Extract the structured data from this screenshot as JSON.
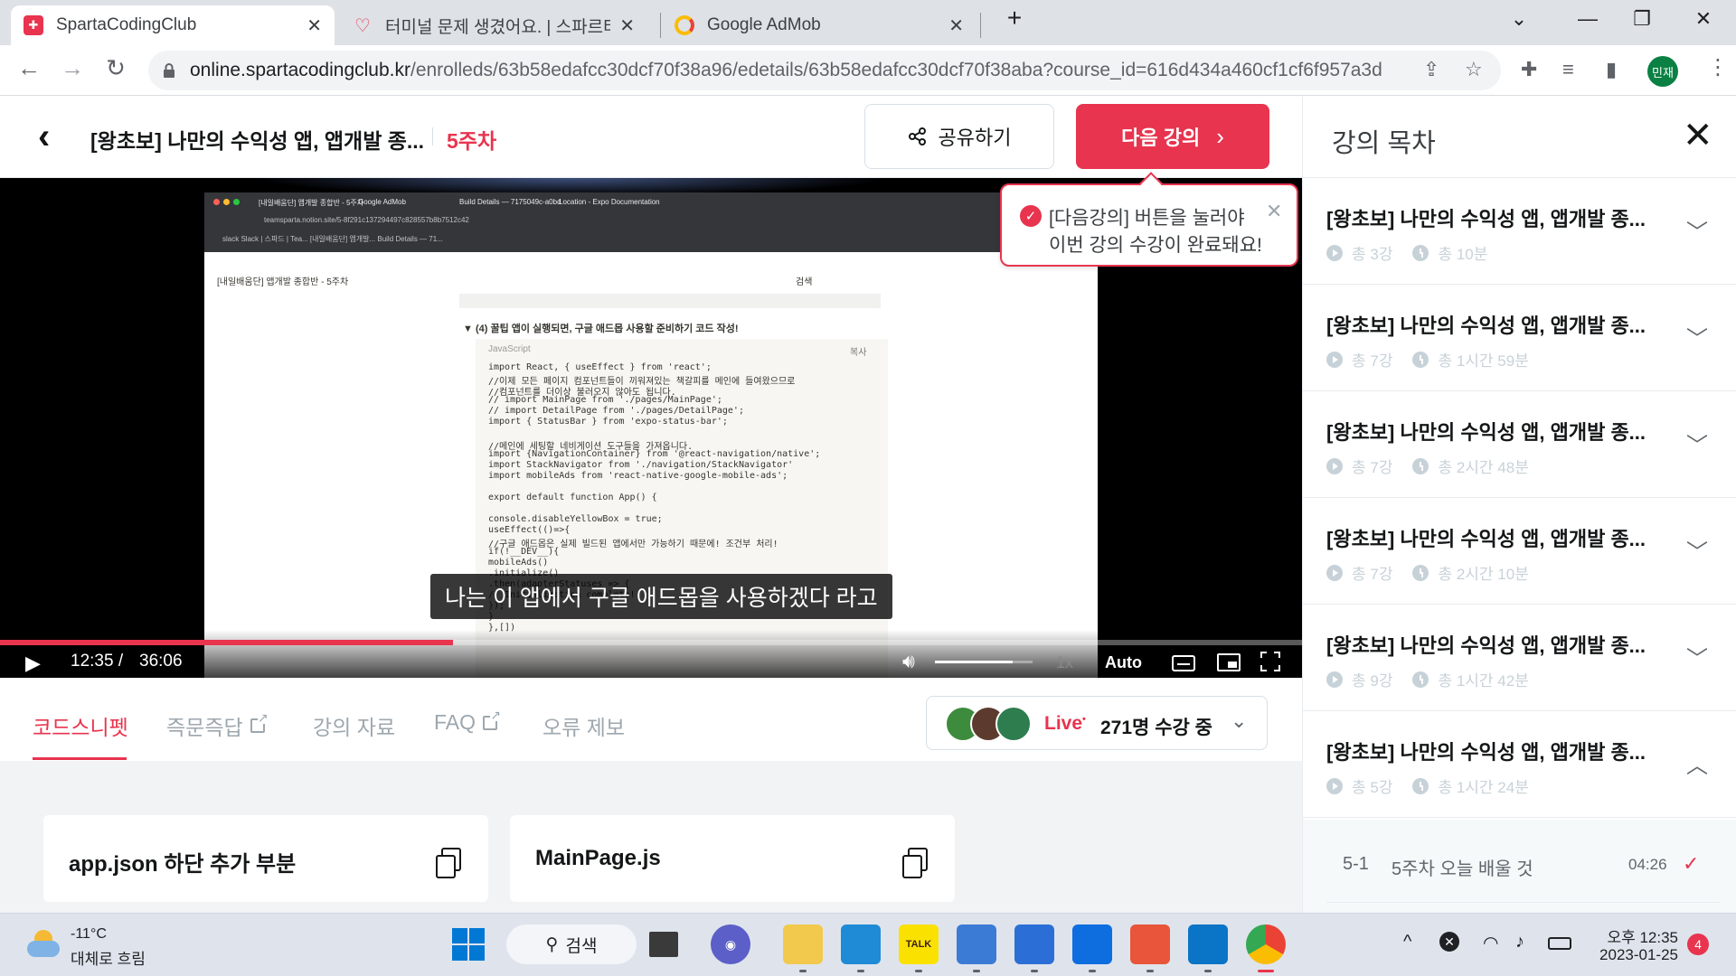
{
  "browser": {
    "tabs": [
      {
        "title": "SpartaCodingClub",
        "favicon_color": "#e8344e",
        "active": true
      },
      {
        "title": "터미널 문제 생겼어요. | 스파르타",
        "favicon_color": "#e8344e",
        "active": false
      },
      {
        "title": "Google AdMob",
        "favicon_color": "#fbbc04",
        "active": false
      }
    ],
    "new_tab": "+",
    "url_host": "online.spartacodingclub.kr",
    "url_path": "/enrolleds/63b58edafcc30dcf70f38a96/edetails/63b58edafcc30dcf70f38aba?course_id=616d434a460cf1cf6f957a3d",
    "profile_initials": "민재"
  },
  "header": {
    "course_title": "[왕초보] 나만의 수익성 앱, 앱개발 종...",
    "week": "5주차",
    "share_label": "공유하기",
    "next_label": "다음 강의"
  },
  "tooltip": {
    "line1": "[다음강의] 버튼을 눌러야",
    "line2": "이번 강의 수강이 완료돼요!"
  },
  "video": {
    "subtitle": "나는 이 앱에서 구글 애드몹을 사용하겠다 라고",
    "current_time": "12:35 /",
    "duration": "36:06",
    "progress": 0.348,
    "volume": 0.8,
    "speed": "1x",
    "quality": "Auto",
    "screen": {
      "tab_titles": [
        "[내일배움단] 앱개발 종합반 - 5주차",
        "Google AdMob",
        "Build Details — 7175049c-a0bd",
        "Location - Expo Documentation"
      ],
      "address": "teamsparta.notion.site/5-8f291c137294497c828557b8b7512c42",
      "bookmarks": "slack   Slack | 스파드 | Tea...   [내일배움단] 앱개발...   Build Details — 71...",
      "notion_header": "[내일배움단] 앱개발 종합반 - 5주차",
      "search_label": "검색",
      "section_heading": "▼  (4) 꿀팁 앱이 실행되면, 구글 애드몹 사용할 준비하기 코드 작성!",
      "code_lang": "JavaScript",
      "copy_label": "복사",
      "code_lines": [
        "import React, { useEffect } from 'react';",
        "//이제 모든 페이지 컴포넌트들이 끼워져있는 책갈피를 메인에 들여왔으므로",
        "//컴포넌트를 더이상 불러오지 않아도 됩니다.",
        "// import MainPage from './pages/MainPage';",
        "// import DetailPage from './pages/DetailPage';",
        "import { StatusBar } from 'expo-status-bar';",
        "",
        "//메인에 세팅할 네비게이션 도구들을 가져옵니다.",
        "import {NavigationContainer} from '@react-navigation/native';",
        "import StackNavigator from './navigation/StackNavigator'",
        "import mobileAds from 'react-native-google-mobile-ads';",
        "",
        "export default function App() {",
        "",
        "  console.disableYellowBox = true;",
        "  useEffect(()=>{",
        "    //구글 애드몹은 실제 빌드된 앱에서만 가능하기 때문에! 조건부 처리!",
        "    if(!__DEV__){",
        "      mobileAds()",
        "        .initialize()",
        "        .then(adapterStatuses => {",
        "          // Initialization complete!",
        "        });",
        "    }",
        "  },[])"
      ]
    }
  },
  "subtabs": [
    {
      "label": "코드스니펫",
      "active": true,
      "external": false
    },
    {
      "label": "즉문즉답",
      "active": false,
      "external": true
    },
    {
      "label": "강의 자료",
      "active": false,
      "external": false
    },
    {
      "label": "FAQ",
      "active": false,
      "external": true
    },
    {
      "label": "오류 제보",
      "active": false,
      "external": false
    }
  ],
  "live": {
    "label": "Live",
    "count_text": "271명 수강 중"
  },
  "snippets": [
    {
      "label": "app.json 하단 추가 부분"
    },
    {
      "label": "MainPage.js"
    }
  ],
  "sidebar": {
    "title": "강의 목차",
    "weeks": [
      {
        "title": "[왕초보] 나만의 수익성 앱, 앱개발 종...",
        "lessons": "총 3강",
        "time": "총 10분",
        "expanded": false
      },
      {
        "title": "[왕초보] 나만의 수익성 앱, 앱개발 종...",
        "lessons": "총 7강",
        "time": "총 1시간 59분",
        "expanded": false
      },
      {
        "title": "[왕초보] 나만의 수익성 앱, 앱개발 종...",
        "lessons": "총 7강",
        "time": "총 2시간 48분",
        "expanded": false
      },
      {
        "title": "[왕초보] 나만의 수익성 앱, 앱개발 종...",
        "lessons": "총 7강",
        "time": "총 2시간 10분",
        "expanded": false
      },
      {
        "title": "[왕초보] 나만의 수익성 앱, 앱개발 종...",
        "lessons": "총 9강",
        "time": "총 1시간 42분",
        "expanded": false
      },
      {
        "title": "[왕초보] 나만의 수익성 앱, 앱개발 종...",
        "lessons": "총 5강",
        "time": "총 1시간 24분",
        "expanded": true
      }
    ],
    "current_lesson": {
      "num": "5-1",
      "title": "5주차 오늘 배울 것",
      "duration": "04:26"
    }
  },
  "taskbar": {
    "temperature": "-11°C",
    "weather": "대체로 흐림",
    "search_label": "검색",
    "time": "오후 12:35",
    "date": "2023-01-25",
    "notifications": "4",
    "apps": [
      {
        "name": "file-explorer",
        "color": "#f2c94c"
      },
      {
        "name": "edge",
        "color": "#1f8ad6"
      },
      {
        "name": "kakaotalk",
        "color": "#fae100"
      },
      {
        "name": "notepad",
        "color": "#3b7bd6"
      },
      {
        "name": "remote",
        "color": "#2b6fd6"
      },
      {
        "name": "teamviewer",
        "color": "#0e6ee0"
      },
      {
        "name": "git",
        "color": "#e8553a"
      },
      {
        "name": "vscode",
        "color": "#0a74c7"
      },
      {
        "name": "chrome",
        "color": "#ffffff"
      }
    ],
    "kakao_label": "TALK"
  }
}
